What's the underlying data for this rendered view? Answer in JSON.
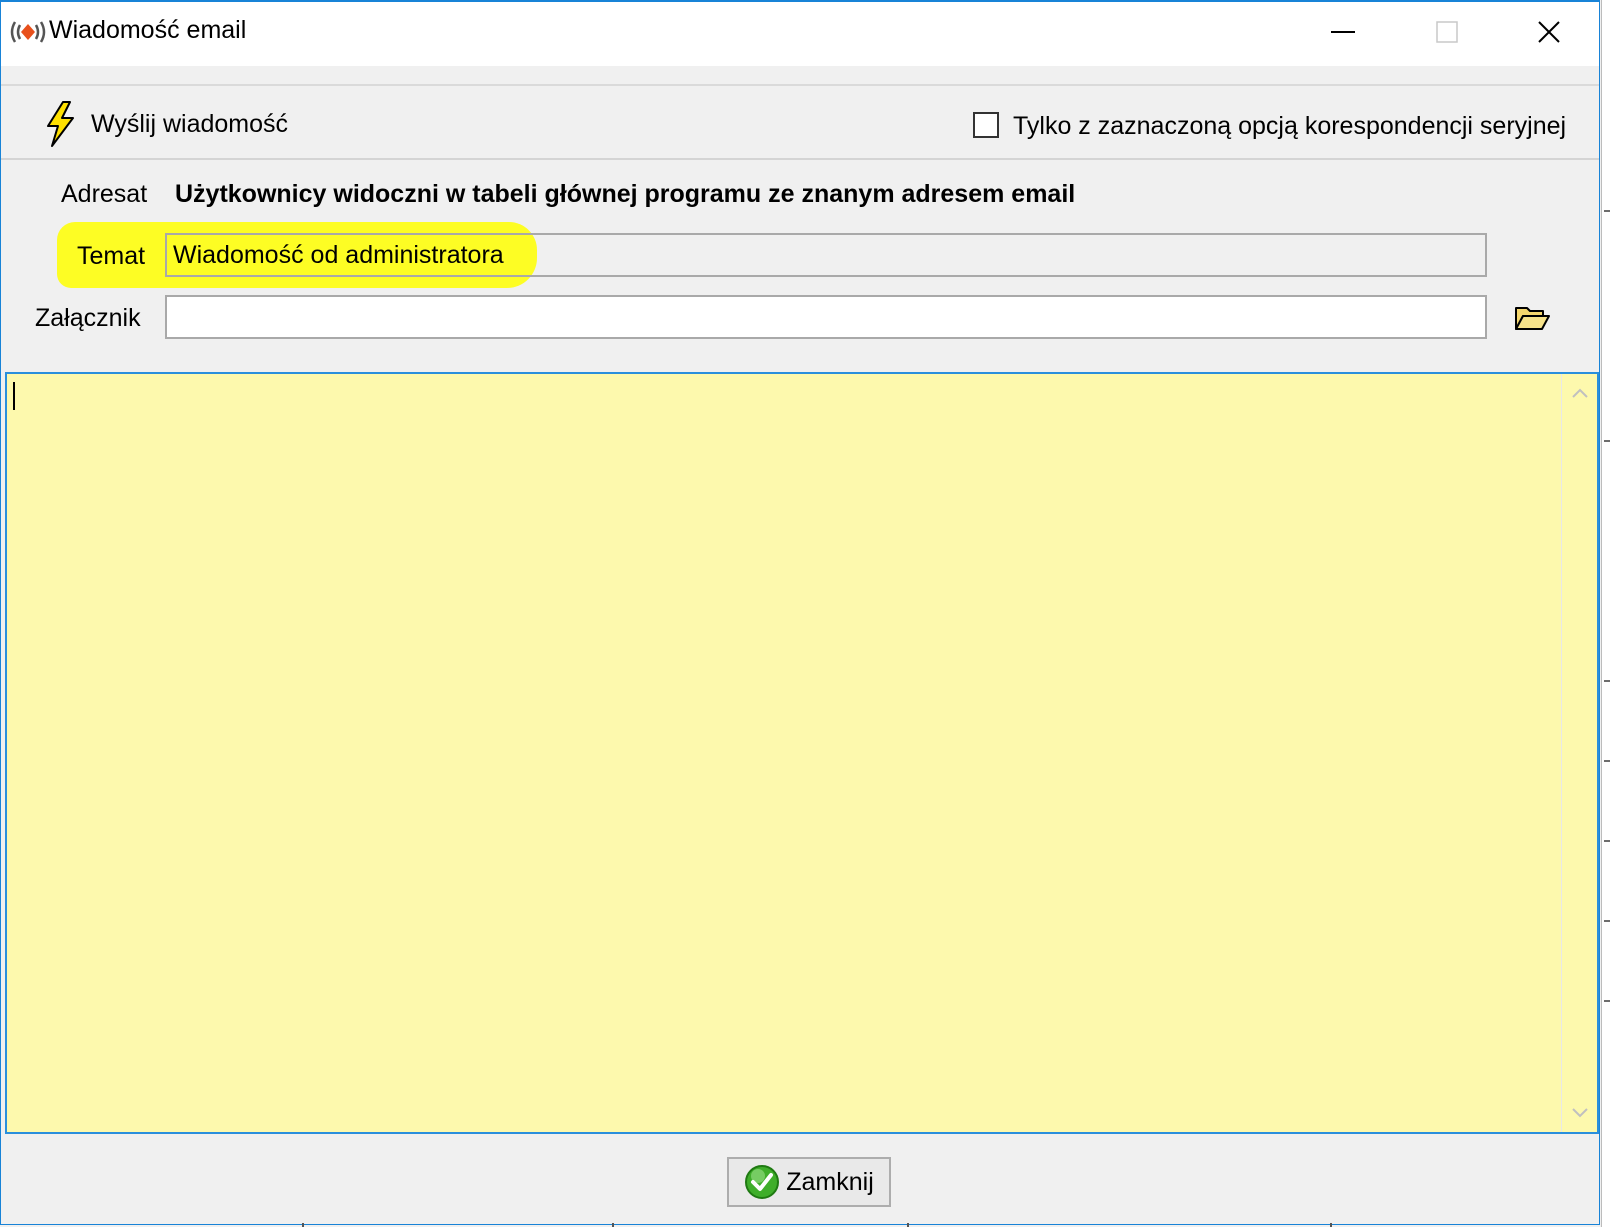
{
  "window": {
    "title": "Wiadomość email",
    "controls": {
      "minimize": "minimize",
      "maximize": "maximize",
      "close": "close"
    }
  },
  "toolbar": {
    "send_label": "Wyślij wiadomość",
    "send_icon": "lightning-bolt-icon",
    "mail_merge_checkbox": {
      "label": "Tylko z zaznaczoną opcją korespondencji seryjnej",
      "checked": false
    }
  },
  "form": {
    "recipient": {
      "label": "Adresat",
      "value": "Użytkownicy widoczni w tabeli głównej programu ze znanym adresem email"
    },
    "subject": {
      "label": "Temat",
      "value": "Wiadomość od administratora",
      "highlighted": true
    },
    "attachment": {
      "label": "Załącznik",
      "value": "",
      "browse_icon": "folder-open-icon"
    }
  },
  "message": {
    "body": "",
    "background": "#fdf9ad"
  },
  "footer": {
    "close_label": "Zamknij",
    "close_icon": "green-check-icon"
  },
  "colors": {
    "window_border": "#1883d7",
    "highlight": "#ffff00",
    "body_background": "#fdf9ad",
    "dialog_background": "#f0f0f0"
  }
}
